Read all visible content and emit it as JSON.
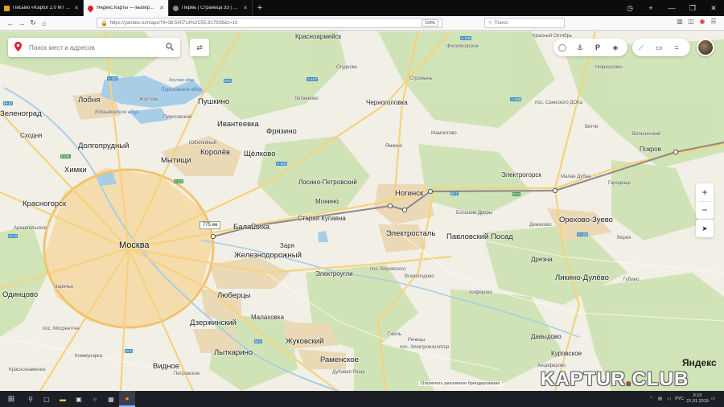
{
  "browser": {
    "tabs": [
      {
        "title": "Письмо «Kaptur 2.0 MT 4x4 -",
        "favicon_color": "#e8a317",
        "active": false
      },
      {
        "title": "Яндекс.Карты — выбирайте ...",
        "favicon_color": "#e31e24",
        "active": true
      },
      {
        "title": "Пермь | Страница 33 | Рено К...",
        "favicon_color": "#888888",
        "active": false
      }
    ],
    "url": "https://yandex.ru/maps/?ll=38.540714%2C55.817939&z=10",
    "zoom": "120%",
    "search_placeholder": "Поиск"
  },
  "map": {
    "search_placeholder": "Поиск мест и адресов",
    "distance_label": "775 км",
    "copyright": "Отключить рекламное брендирование",
    "yandex_logo": "Яндекс",
    "towns": [
      {
        "name": "Москва",
        "size": "huge"
      },
      {
        "name": "Лобня",
        "size": "big"
      },
      {
        "name": "Долгопрудный",
        "size": "big"
      },
      {
        "name": "Химки",
        "size": "big"
      },
      {
        "name": "Красногорск",
        "size": "big"
      },
      {
        "name": "Мытищи",
        "size": "big"
      },
      {
        "name": "Королёв",
        "size": "big"
      },
      {
        "name": "Пушкино",
        "size": "big"
      },
      {
        "name": "Ивантеевка",
        "size": "big"
      },
      {
        "name": "Фрязино",
        "size": "big"
      },
      {
        "name": "Щёлково",
        "size": "big"
      },
      {
        "name": "Лосино-Петровский",
        "size": "normal"
      },
      {
        "name": "Монино",
        "size": "normal"
      },
      {
        "name": "Старая Купавна",
        "size": "normal"
      },
      {
        "name": "Балашиха",
        "size": "big"
      },
      {
        "name": "Железнодорожный",
        "size": "big"
      },
      {
        "name": "Ногинск",
        "size": "big"
      },
      {
        "name": "Электросталь",
        "size": "big"
      },
      {
        "name": "Павловский Посад",
        "size": "big"
      },
      {
        "name": "Электрогорск",
        "size": "normal"
      },
      {
        "name": "Орехово-Зуево",
        "size": "big"
      },
      {
        "name": "Ликино-Дулёво",
        "size": "big"
      },
      {
        "name": "Люберцы",
        "size": "big"
      },
      {
        "name": "Дзержинский",
        "size": "big"
      },
      {
        "name": "Лыткарино",
        "size": "big"
      },
      {
        "name": "Жуковский",
        "size": "big"
      },
      {
        "name": "Раменское",
        "size": "big"
      },
      {
        "name": "Видное",
        "size": "big"
      },
      {
        "name": "Одинцово",
        "size": "big"
      },
      {
        "name": "Красноармейск",
        "size": "normal"
      },
      {
        "name": "Черноголовка",
        "size": "normal"
      },
      {
        "name": "Покров",
        "size": "normal"
      },
      {
        "name": "Дрезна",
        "size": "normal"
      },
      {
        "name": "Давыдово",
        "size": "normal"
      },
      {
        "name": "Куровское",
        "size": "normal"
      },
      {
        "name": "Зеленоград",
        "size": "big"
      },
      {
        "name": "Сходня",
        "size": "normal"
      },
      {
        "name": "Электроугли",
        "size": "normal"
      },
      {
        "name": "Заря",
        "size": "normal"
      },
      {
        "name": "Малаховка",
        "size": "normal"
      },
      {
        "name": "Новоселово",
        "size": "small"
      },
      {
        "name": "Красный Октябрь",
        "size": "small"
      },
      {
        "name": "Филипповское",
        "size": "small"
      },
      {
        "name": "Огудново",
        "size": "small"
      },
      {
        "name": "Стромынь",
        "size": "small"
      },
      {
        "name": "Мамонтово",
        "size": "small"
      },
      {
        "name": "Ямкино",
        "size": "small"
      },
      {
        "name": "Литвиново",
        "size": "small"
      },
      {
        "name": "Жостово",
        "size": "small"
      },
      {
        "name": "Пироговский",
        "size": "small"
      },
      {
        "name": "Юбилейный",
        "size": "small"
      },
      {
        "name": "Ветчи",
        "size": "small"
      },
      {
        "name": "Вольгинский",
        "size": "small"
      },
      {
        "name": "Малая Дубна",
        "size": "small"
      },
      {
        "name": "Городищи",
        "size": "small"
      },
      {
        "name": "Большие Дворы",
        "size": "small"
      },
      {
        "name": "Демихово",
        "size": "small"
      },
      {
        "name": "Верея",
        "size": "small"
      },
      {
        "name": "пос. Саниского ДОКа",
        "size": "small"
      },
      {
        "name": "пос. Воровского",
        "size": "small"
      },
      {
        "name": "Всеволодово",
        "size": "small"
      },
      {
        "name": "Алфёрово",
        "size": "small"
      },
      {
        "name": "Гжель",
        "size": "small"
      },
      {
        "name": "Речицы",
        "size": "small"
      },
      {
        "name": "пос. Электроизолятор",
        "size": "small"
      },
      {
        "name": "Анциферово",
        "size": "small"
      },
      {
        "name": "Губино",
        "size": "small"
      },
      {
        "name": "пос. Мосрентген",
        "size": "small"
      },
      {
        "name": "Коммунарка",
        "size": "small"
      },
      {
        "name": "Петровское",
        "size": "small"
      },
      {
        "name": "Дубовая Роща",
        "size": "small"
      },
      {
        "name": "Заречье",
        "size": "small"
      },
      {
        "name": "Архангельское",
        "size": "small"
      },
      {
        "name": "Краснознаменск",
        "size": "small"
      }
    ],
    "lake_labels": [
      "Клязьминское вдхр.",
      "Пироговское вдхр.",
      "Акулово вдхр."
    ],
    "highways": [
      "A-104",
      "М-8",
      "A-107",
      "M-7",
      "E22",
      "A-108",
      "M-5",
      "M-4",
      "E115",
      "E105",
      "M-10",
      "A-106",
      "A-105",
      "A-103",
      "M-12"
    ]
  },
  "taskbar": {
    "lang": "РУС",
    "time": "9:10",
    "date": "21.01.2019"
  },
  "watermark": {
    "text_left": "KAPTUR",
    "dot": ".",
    "text_right": "CLUB"
  }
}
